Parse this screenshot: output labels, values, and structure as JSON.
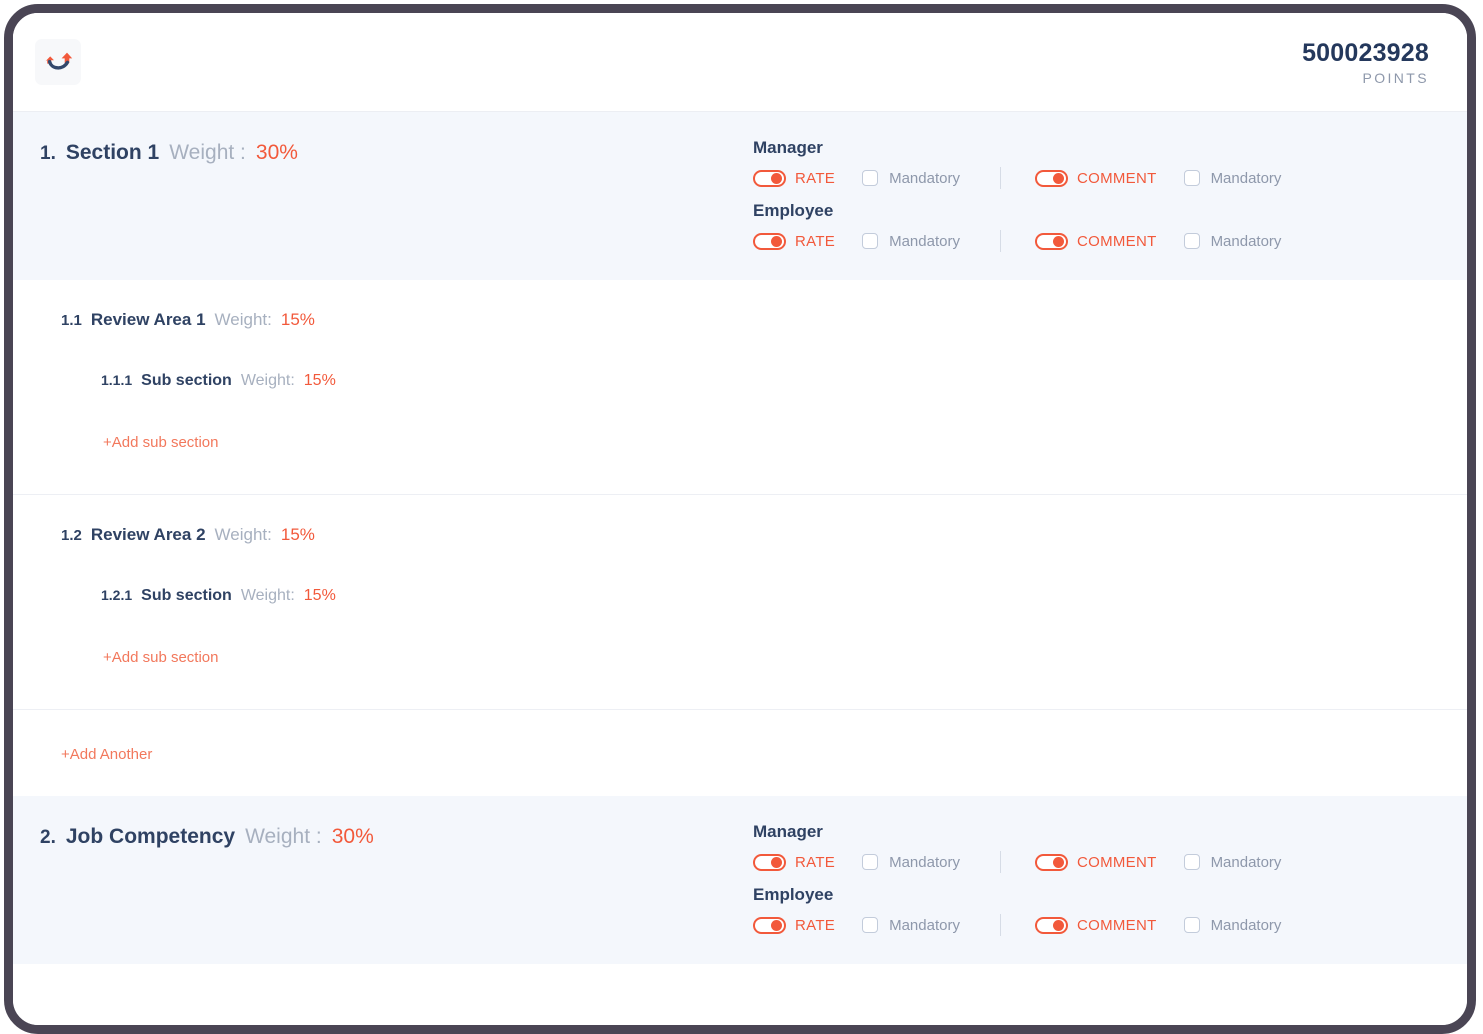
{
  "header": {
    "logo_icon": "company-swoosh-logo",
    "points_value": "500023928",
    "points_label": "POINTS"
  },
  "colors": {
    "accent": "#f2593b",
    "accent_light": "#f2785c",
    "heading": "#2f4263",
    "muted": "#a7b0bf",
    "band_bg": "#f4f7fc",
    "frame": "#4a4554"
  },
  "labels": {
    "rate": "RATE",
    "comment": "COMMENT",
    "mandatory": "Mandatory",
    "manager": "Manager",
    "employee": "Employee",
    "weight_colon": "Weight :",
    "weight_colon_tight": "Weight:",
    "add_sub_section": "+Add sub section",
    "add_another": "+Add Another"
  },
  "sections": [
    {
      "number": "1.",
      "name": "Section 1",
      "weight_label": "Weight :",
      "weight_value": "30%",
      "roles": [
        {
          "role": "Manager",
          "rate_label": "RATE",
          "rate_on": true,
          "rate_mandatory_label": "Mandatory",
          "rate_mandatory_checked": false,
          "comment_label": "COMMENT",
          "comment_on": true,
          "comment_mandatory_label": "Mandatory",
          "comment_mandatory_checked": false
        },
        {
          "role": "Employee",
          "rate_label": "RATE",
          "rate_on": true,
          "rate_mandatory_label": "Mandatory",
          "rate_mandatory_checked": false,
          "comment_label": "COMMENT",
          "comment_on": true,
          "comment_mandatory_label": "Mandatory",
          "comment_mandatory_checked": false
        }
      ],
      "review_areas": [
        {
          "number": "1.1",
          "name": "Review Area 1",
          "weight_label": "Weight:",
          "weight_value": "15%",
          "sub_sections": [
            {
              "number": "1.1.1",
              "name": "Sub section",
              "weight_label": "Weight:",
              "weight_value": "15%"
            }
          ],
          "add_sub_section": "+Add sub section"
        },
        {
          "number": "1.2",
          "name": "Review Area 2",
          "weight_label": "Weight:",
          "weight_value": "15%",
          "sub_sections": [
            {
              "number": "1.2.1",
              "name": "Sub section",
              "weight_label": "Weight:",
              "weight_value": "15%"
            }
          ],
          "add_sub_section": "+Add sub section"
        }
      ],
      "add_another": "+Add Another"
    },
    {
      "number": "2.",
      "name": "Job Competency",
      "weight_label": "Weight :",
      "weight_value": "30%",
      "roles": [
        {
          "role": "Manager",
          "rate_label": "RATE",
          "rate_on": true,
          "rate_mandatory_label": "Mandatory",
          "rate_mandatory_checked": false,
          "comment_label": "COMMENT",
          "comment_on": true,
          "comment_mandatory_label": "Mandatory",
          "comment_mandatory_checked": false
        },
        {
          "role": "Employee",
          "rate_label": "RATE",
          "rate_on": true,
          "rate_mandatory_label": "Mandatory",
          "rate_mandatory_checked": false,
          "comment_label": "COMMENT",
          "comment_on": true,
          "comment_mandatory_label": "Mandatory",
          "comment_mandatory_checked": false
        }
      ],
      "review_areas": [],
      "add_another": ""
    }
  ]
}
